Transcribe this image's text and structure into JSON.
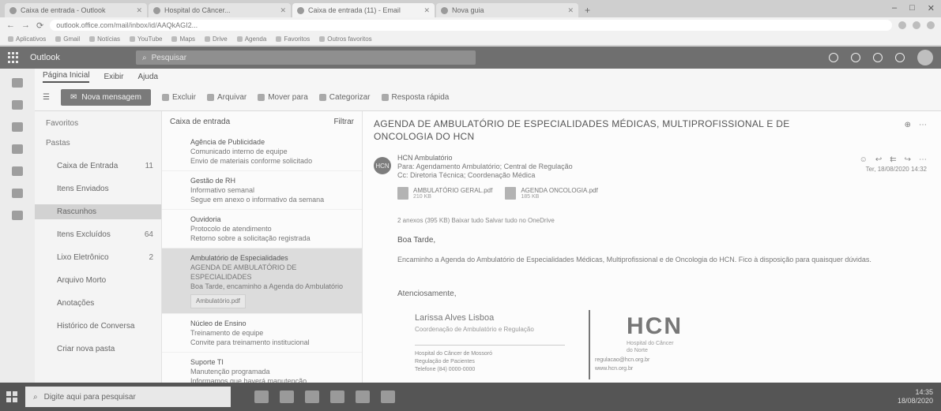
{
  "browser": {
    "tabs": [
      {
        "title": "Caixa de entrada - Outlook"
      },
      {
        "title": "Hospital do Câncer..."
      },
      {
        "title": "Caixa de entrada (11) - Email"
      },
      {
        "title": "Nova guia"
      }
    ],
    "new_tab": "+",
    "window_controls": [
      "–",
      "□",
      "✕"
    ],
    "nav": {
      "back": "←",
      "forward": "→",
      "reload": "⟳"
    },
    "url": "outlook.office.com/mail/inbox/id/AAQkAGI2..."
  },
  "bookmarks": [
    "Aplicativos",
    "Gmail",
    "Notícias",
    "YouTube",
    "Maps",
    "Drive",
    "Agenda",
    "Favoritos",
    "Outros favoritos"
  ],
  "app": {
    "name": "Outlook",
    "search_placeholder": "Pesquisar"
  },
  "ribbon": {
    "tabs": [
      "Página Inicial",
      "Exibir",
      "Ajuda"
    ],
    "new_message": "Nova mensagem",
    "buttons": [
      "Excluir",
      "Arquivar",
      "Mover para",
      "Categorizar",
      "Resposta rápida"
    ]
  },
  "folders": {
    "favorites_label": "Favoritos",
    "folders_label": "Pastas",
    "items": [
      {
        "name": "Caixa de Entrada",
        "count": "11"
      },
      {
        "name": "Itens Enviados",
        "count": ""
      },
      {
        "name": "Rascunhos",
        "count": ""
      },
      {
        "name": "Itens Excluídos",
        "count": "64"
      },
      {
        "name": "Lixo Eletrônico",
        "count": "2"
      },
      {
        "name": "Arquivo Morto",
        "count": ""
      },
      {
        "name": "Anotações",
        "count": ""
      },
      {
        "name": "Histórico de Conversa",
        "count": ""
      }
    ],
    "new_folder": "Criar nova pasta"
  },
  "list": {
    "header": "Caixa de entrada",
    "filter": "Filtrar",
    "messages": [
      {
        "from": "Agência de Publicidade",
        "subject": "Comunicado interno de equipe",
        "preview": "Envio de materiais conforme solicitado"
      },
      {
        "from": "Gestão de RH",
        "subject": "Informativo semanal",
        "preview": "Segue em anexo o informativo da semana"
      },
      {
        "from": "Ouvidoria",
        "subject": "Protocolo de atendimento",
        "preview": "Retorno sobre a solicitação registrada"
      },
      {
        "from": "Ambulatório de Especialidades",
        "subject": "AGENDA DE AMBULATÓRIO DE ESPECIALIDADES",
        "preview": "Boa Tarde, encaminho a Agenda do Ambulatório",
        "attachment": "Ambulatório.pdf"
      },
      {
        "from": "Núcleo de Ensino",
        "subject": "Treinamento de equipe",
        "preview": "Convite para treinamento institucional"
      },
      {
        "from": "Suporte TI",
        "subject": "Manutenção programada",
        "preview": "Informamos que haverá manutenção"
      }
    ]
  },
  "email": {
    "subject": "AGENDA DE AMBULATÓRIO DE ESPECIALIDADES MÉDICAS, MULTIPROFISSIONAL E DE ONCOLOGIA DO HCN",
    "sender_initials": "HCN",
    "sender_name": "HCN Ambulatório",
    "to_line": "Para: Agendamento Ambulatório; Central de Regulação",
    "cc_line": "Cc: Diretoria Técnica; Coordenação Médica",
    "date": "Ter, 18/08/2020 14:32",
    "attachments": [
      {
        "name": "AMBULATÓRIO GERAL.pdf",
        "size": "210 KB"
      },
      {
        "name": "AGENDA ONCOLOGIA.pdf",
        "size": "185 KB"
      }
    ],
    "download_all": "2 anexos (395 KB)  Baixar tudo  Salvar tudo no OneDrive",
    "greeting": "Boa Tarde,",
    "body": "Encaminho a Agenda do Ambulatório de Especialidades Médicas, Multiprofissional e de Oncologia do HCN. Fico à disposição para quaisquer dúvidas.",
    "closing": "Atenciosamente,",
    "sig_name": "Larissa Alves Lisboa",
    "sig_role": "Coordenação de Ambulatório e Regulação",
    "sig_details": [
      "Hospital do Câncer de Mossoró",
      "Regulação de Pacientes",
      "Telefone (84) 0000-0000"
    ],
    "logo_text": "HCN",
    "logo_sub": [
      "Hospital do Câncer",
      "do Norte"
    ],
    "contact": [
      "regulacao@hcn.org.br",
      "www.hcn.org.br"
    ]
  },
  "taskbar": {
    "search_placeholder": "Digite aqui para pesquisar",
    "time": "14:35",
    "date": "18/08/2020"
  }
}
